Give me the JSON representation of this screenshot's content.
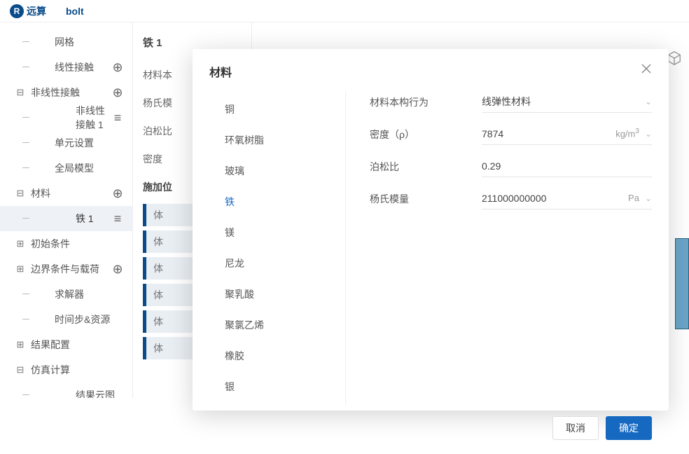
{
  "header": {
    "brand_mark": "R",
    "brand": "远算",
    "project": "bolt"
  },
  "sidebar": {
    "items": [
      {
        "label": "网格",
        "depth": 1,
        "expander": "",
        "right": "",
        "line": true
      },
      {
        "label": "线性接触",
        "depth": 1,
        "expander": "",
        "right": "⊕",
        "line": true
      },
      {
        "label": "非线性接触",
        "depth": 0,
        "expander": "⊟",
        "right": "⊕",
        "line": false
      },
      {
        "label": "非线性接触 1",
        "depth": 2,
        "expander": "",
        "right": "≡",
        "line": true
      },
      {
        "label": "单元设置",
        "depth": 1,
        "expander": "",
        "right": "",
        "line": true
      },
      {
        "label": "全局模型",
        "depth": 1,
        "expander": "",
        "right": "",
        "line": true
      },
      {
        "label": "材料",
        "depth": 0,
        "expander": "⊟",
        "right": "⊕",
        "line": false
      },
      {
        "label": "铁 1",
        "depth": 2,
        "expander": "",
        "right": "≡",
        "line": true,
        "active": true
      },
      {
        "label": "初始条件",
        "depth": 0,
        "expander": "⊞",
        "right": "",
        "line": false
      },
      {
        "label": "边界条件与载荷",
        "depth": 0,
        "expander": "⊞",
        "right": "⊕",
        "line": false
      },
      {
        "label": "求解器",
        "depth": 1,
        "expander": "",
        "right": "",
        "line": true
      },
      {
        "label": "时间步&资源",
        "depth": 1,
        "expander": "",
        "right": "",
        "line": true
      },
      {
        "label": "结果配置",
        "depth": 0,
        "expander": "⊞",
        "right": "",
        "line": false
      },
      {
        "label": "仿真计算",
        "depth": 0,
        "expander": "⊟",
        "right": "",
        "line": false
      },
      {
        "label": "结果云图",
        "depth": 2,
        "expander": "",
        "right": "",
        "line": true
      }
    ]
  },
  "detail": {
    "title": "铁 1",
    "fields": [
      "材料本",
      "杨氏模",
      "泊松比",
      "密度"
    ],
    "section": "施加位",
    "chips": [
      "体",
      "体",
      "体",
      "体",
      "体",
      "体"
    ]
  },
  "modal": {
    "title": "材料",
    "materials": [
      "铜",
      "环氧树脂",
      "玻璃",
      "铁",
      "镁",
      "尼龙",
      "聚乳酸",
      "聚氯乙烯",
      "橡胶",
      "银"
    ],
    "selected_index": 3,
    "form": [
      {
        "label": "材料本构行为",
        "value": "线弹性材料",
        "unit": "",
        "dropdown": true
      },
      {
        "label": "密度（ρ）",
        "value": "7874",
        "unit": "kg/m³",
        "dropdown": true
      },
      {
        "label": "泊松比",
        "value": "0.29",
        "unit": "",
        "dropdown": false
      },
      {
        "label": "杨氏模量",
        "value": "211000000000",
        "unit": "Pa",
        "dropdown": true
      }
    ],
    "cancel": "取消",
    "ok": "确定"
  }
}
